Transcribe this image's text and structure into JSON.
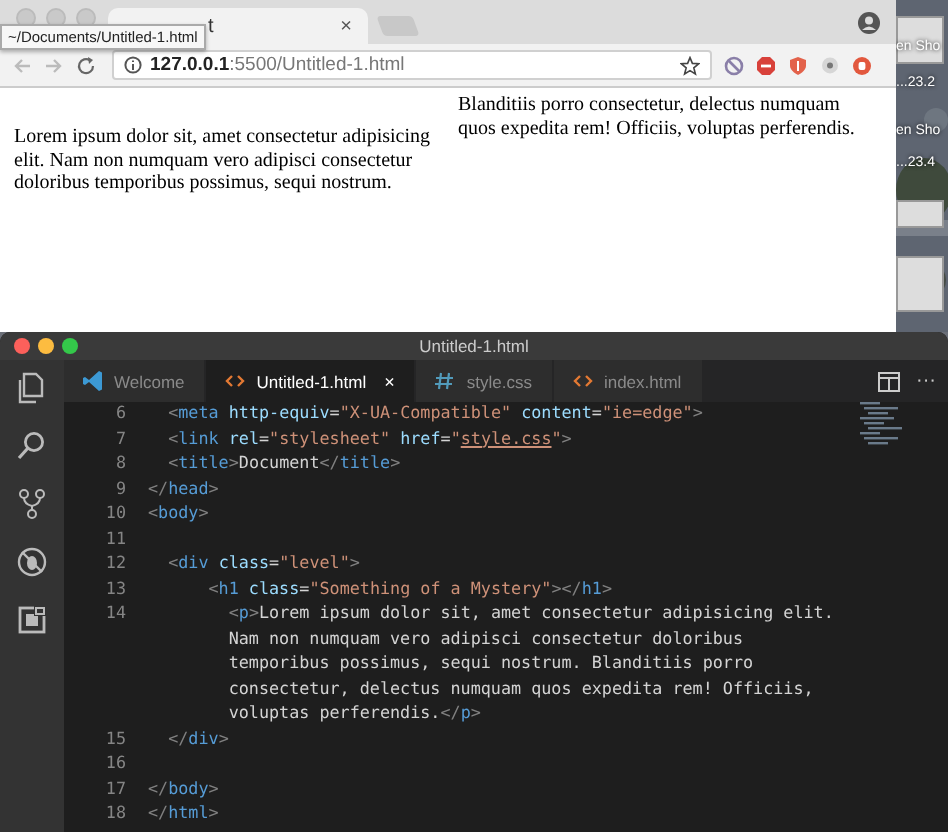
{
  "browser": {
    "tab": {
      "title": "t",
      "close": "×"
    },
    "tooltip": "~/Documents/Untitled-1.html",
    "address": "**127.0.0.1**:5500/Untitled-1.html",
    "columns": [
      {
        "text": "Lorem ipsum dolor sit, amet consectetur adipisicing elit. Nam non numquam vero adipisci consectetur doloribus temporibus possimus, sequi nostrum."
      },
      {
        "text": "Blanditiis porro consectetur, delectus numquam quos expedita rem! Officiis, voluptas perferendis."
      }
    ]
  },
  "desktop": {
    "labels": [
      "en Sho",
      "...23.2",
      "en Sho",
      "...23.4"
    ]
  },
  "editor": {
    "title": "Untitled-1.html",
    "more": "···",
    "tabs": [
      {
        "label": "Welcome",
        "kind": "welcome",
        "selected": false
      },
      {
        "label": "Untitled-1.html",
        "kind": "html",
        "selected": true,
        "close": "×"
      },
      {
        "label": "style.css",
        "kind": "css",
        "selected": false
      },
      {
        "label": "index.html",
        "kind": "html",
        "selected": false
      }
    ],
    "lines": [
      {
        "number": "6",
        "tokens": [
          {
            "t": "  <",
            "kind": "bracket"
          },
          {
            "t": "meta",
            "kind": "tag"
          },
          {
            "t": " http-equiv",
            "kind": "attr"
          },
          {
            "t": "=",
            "kind": "text"
          },
          {
            "t": "\"X-UA-Compatible\"",
            "kind": "string"
          },
          {
            "t": " content",
            "kind": "attr"
          },
          {
            "t": "=",
            "kind": "text"
          },
          {
            "t": "\"ie=edge\"",
            "kind": "string"
          },
          {
            "t": ">",
            "kind": "bracket"
          }
        ]
      },
      {
        "number": "7",
        "tokens": [
          {
            "t": "  <",
            "kind": "bracket"
          },
          {
            "t": "link",
            "kind": "tag"
          },
          {
            "t": " rel",
            "kind": "attr"
          },
          {
            "t": "=",
            "kind": "text"
          },
          {
            "t": "\"stylesheet\"",
            "kind": "string"
          },
          {
            "t": " href",
            "kind": "attr"
          },
          {
            "t": "=",
            "kind": "text"
          },
          {
            "t": "\"",
            "kind": "string"
          },
          {
            "t": "style.css",
            "kind": "link"
          },
          {
            "t": "\"",
            "kind": "string"
          },
          {
            "t": ">",
            "kind": "bracket"
          }
        ]
      },
      {
        "number": "8",
        "tokens": [
          {
            "t": "  <",
            "kind": "bracket"
          },
          {
            "t": "title",
            "kind": "tag"
          },
          {
            "t": ">",
            "kind": "bracket"
          },
          {
            "t": "Document",
            "kind": "text"
          },
          {
            "t": "</",
            "kind": "bracket"
          },
          {
            "t": "title",
            "kind": "tag"
          },
          {
            "t": ">",
            "kind": "bracket"
          }
        ]
      },
      {
        "number": "9",
        "tokens": [
          {
            "t": "</",
            "kind": "bracket"
          },
          {
            "t": "head",
            "kind": "tag"
          },
          {
            "t": ">",
            "kind": "bracket"
          }
        ]
      },
      {
        "number": "10",
        "tokens": [
          {
            "t": "<",
            "kind": "bracket"
          },
          {
            "t": "body",
            "kind": "tag"
          },
          {
            "t": ">",
            "kind": "bracket"
          }
        ]
      },
      {
        "number": "11"
      },
      {
        "number": "12",
        "tokens": [
          {
            "t": "  <",
            "kind": "bracket"
          },
          {
            "t": "div",
            "kind": "tag"
          },
          {
            "t": " class",
            "kind": "attr"
          },
          {
            "t": "=",
            "kind": "text"
          },
          {
            "t": "\"level\"",
            "kind": "string"
          },
          {
            "t": ">",
            "kind": "bracket"
          }
        ]
      },
      {
        "number": "13",
        "tokens": [
          {
            "t": "      <",
            "kind": "bracket"
          },
          {
            "t": "h1",
            "kind": "tag"
          },
          {
            "t": " class",
            "kind": "attr"
          },
          {
            "t": "=",
            "kind": "text"
          },
          {
            "t": "\"Something of a Mystery\"",
            "kind": "string"
          },
          {
            "t": "></",
            "kind": "bracket"
          },
          {
            "t": "h1",
            "kind": "tag"
          },
          {
            "t": ">",
            "kind": "bracket"
          }
        ]
      },
      {
        "number": "14",
        "tokens": [
          {
            "t": "        <",
            "kind": "bracket"
          },
          {
            "t": "p",
            "kind": "tag"
          },
          {
            "t": ">",
            "kind": "bracket"
          },
          {
            "t": "Lorem ipsum dolor sit, amet consectetur adipisicing elit.",
            "kind": "text"
          }
        ]
      },
      {
        "tokens": [
          {
            "t": "        Nam non numquam vero adipisci consectetur doloribus",
            "kind": "text"
          }
        ]
      },
      {
        "tokens": [
          {
            "t": "        temporibus possimus, sequi nostrum. Blanditiis porro",
            "kind": "text"
          }
        ]
      },
      {
        "tokens": [
          {
            "t": "        consectetur, delectus numquam quos expedita rem! Officiis,",
            "kind": "text"
          }
        ]
      },
      {
        "tokens": [
          {
            "t": "        voluptas perferendis.",
            "kind": "text"
          },
          {
            "t": "</",
            "kind": "bracket"
          },
          {
            "t": "p",
            "kind": "tag"
          },
          {
            "t": ">",
            "kind": "bracket"
          }
        ]
      },
      {
        "number": "15",
        "tokens": [
          {
            "t": "  </",
            "kind": "bracket"
          },
          {
            "t": "div",
            "kind": "tag"
          },
          {
            "t": ">",
            "kind": "bracket"
          }
        ]
      },
      {
        "number": "16"
      },
      {
        "number": "17",
        "tokens": [
          {
            "t": "</",
            "kind": "bracket"
          },
          {
            "t": "body",
            "kind": "tag"
          },
          {
            "t": ">",
            "kind": "bracket"
          }
        ]
      },
      {
        "number": "18",
        "tokens": [
          {
            "t": "</",
            "kind": "bracket"
          },
          {
            "t": "html",
            "kind": "tag"
          },
          {
            "t": ">",
            "kind": "bracket"
          }
        ]
      }
    ]
  }
}
